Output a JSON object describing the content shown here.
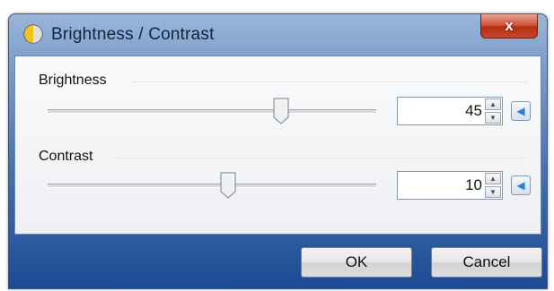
{
  "window": {
    "title": "Brightness / Contrast",
    "title_icon": "brightness-contrast-icon",
    "close_label": "x"
  },
  "brightness": {
    "label": "Brightness",
    "value": "45",
    "slider_fraction": 0.71
  },
  "contrast": {
    "label": "Contrast",
    "value": "10",
    "slider_fraction": 0.55
  },
  "buttons": {
    "ok": "OK",
    "cancel": "Cancel"
  },
  "icons": {
    "spin_up": "▲",
    "spin_down": "▼",
    "reset": "◀"
  },
  "colors": {
    "accent": "#2c7fd8",
    "close": "#c8462b"
  }
}
